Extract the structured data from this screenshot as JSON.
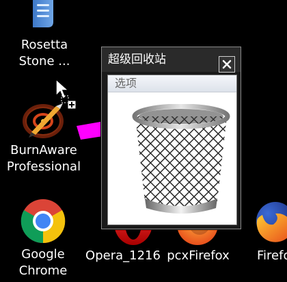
{
  "desktop": {
    "icons": [
      {
        "id": "rosetta",
        "label_lines": [
          "Rosetta",
          "Stone ..."
        ]
      },
      {
        "id": "burnaware",
        "label_lines": [
          "BurnAware",
          "Professional"
        ]
      },
      {
        "id": "chrome",
        "label_lines": [
          "Google",
          "Chrome"
        ]
      },
      {
        "id": "opera",
        "label_lines": [
          "Opera_1216"
        ]
      },
      {
        "id": "pcxfirefox",
        "label_lines": [
          "pcxFirefox"
        ]
      },
      {
        "id": "firefox",
        "label_lines": [
          "Firefo"
        ]
      }
    ]
  },
  "window": {
    "title": "超级回收站",
    "menu": [
      "选项"
    ]
  },
  "colors": {
    "desktop_bg": "#000000",
    "arrow": "#ff00ff"
  },
  "icons": {
    "rosetta": "rosetta-stone-icon",
    "burnaware": "burnaware-icon",
    "chrome": "chrome-icon",
    "opera": "opera-icon",
    "pcxfirefox": "pcxfirefox-icon",
    "firefox": "firefox-icon",
    "cursor": "mouse-cursor-copy-icon",
    "arrow": "magenta-arrow-icon",
    "close": "close-icon",
    "bin": "recycle-bin-icon"
  }
}
